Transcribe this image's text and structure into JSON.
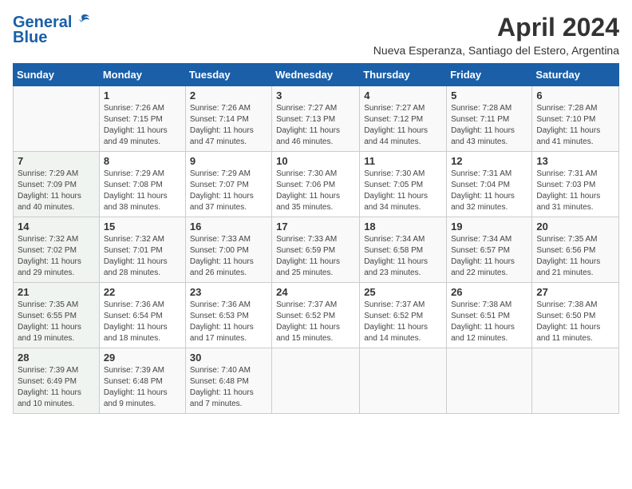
{
  "logo": {
    "line1": "General",
    "line2": "Blue"
  },
  "title": "April 2024",
  "subtitle": "Nueva Esperanza, Santiago del Estero, Argentina",
  "header_days": [
    "Sunday",
    "Monday",
    "Tuesday",
    "Wednesday",
    "Thursday",
    "Friday",
    "Saturday"
  ],
  "weeks": [
    [
      {
        "day": "",
        "info": ""
      },
      {
        "day": "1",
        "info": "Sunrise: 7:26 AM\nSunset: 7:15 PM\nDaylight: 11 hours\nand 49 minutes."
      },
      {
        "day": "2",
        "info": "Sunrise: 7:26 AM\nSunset: 7:14 PM\nDaylight: 11 hours\nand 47 minutes."
      },
      {
        "day": "3",
        "info": "Sunrise: 7:27 AM\nSunset: 7:13 PM\nDaylight: 11 hours\nand 46 minutes."
      },
      {
        "day": "4",
        "info": "Sunrise: 7:27 AM\nSunset: 7:12 PM\nDaylight: 11 hours\nand 44 minutes."
      },
      {
        "day": "5",
        "info": "Sunrise: 7:28 AM\nSunset: 7:11 PM\nDaylight: 11 hours\nand 43 minutes."
      },
      {
        "day": "6",
        "info": "Sunrise: 7:28 AM\nSunset: 7:10 PM\nDaylight: 11 hours\nand 41 minutes."
      }
    ],
    [
      {
        "day": "7",
        "info": "Sunrise: 7:29 AM\nSunset: 7:09 PM\nDaylight: 11 hours\nand 40 minutes."
      },
      {
        "day": "8",
        "info": "Sunrise: 7:29 AM\nSunset: 7:08 PM\nDaylight: 11 hours\nand 38 minutes."
      },
      {
        "day": "9",
        "info": "Sunrise: 7:29 AM\nSunset: 7:07 PM\nDaylight: 11 hours\nand 37 minutes."
      },
      {
        "day": "10",
        "info": "Sunrise: 7:30 AM\nSunset: 7:06 PM\nDaylight: 11 hours\nand 35 minutes."
      },
      {
        "day": "11",
        "info": "Sunrise: 7:30 AM\nSunset: 7:05 PM\nDaylight: 11 hours\nand 34 minutes."
      },
      {
        "day": "12",
        "info": "Sunrise: 7:31 AM\nSunset: 7:04 PM\nDaylight: 11 hours\nand 32 minutes."
      },
      {
        "day": "13",
        "info": "Sunrise: 7:31 AM\nSunset: 7:03 PM\nDaylight: 11 hours\nand 31 minutes."
      }
    ],
    [
      {
        "day": "14",
        "info": "Sunrise: 7:32 AM\nSunset: 7:02 PM\nDaylight: 11 hours\nand 29 minutes."
      },
      {
        "day": "15",
        "info": "Sunrise: 7:32 AM\nSunset: 7:01 PM\nDaylight: 11 hours\nand 28 minutes."
      },
      {
        "day": "16",
        "info": "Sunrise: 7:33 AM\nSunset: 7:00 PM\nDaylight: 11 hours\nand 26 minutes."
      },
      {
        "day": "17",
        "info": "Sunrise: 7:33 AM\nSunset: 6:59 PM\nDaylight: 11 hours\nand 25 minutes."
      },
      {
        "day": "18",
        "info": "Sunrise: 7:34 AM\nSunset: 6:58 PM\nDaylight: 11 hours\nand 23 minutes."
      },
      {
        "day": "19",
        "info": "Sunrise: 7:34 AM\nSunset: 6:57 PM\nDaylight: 11 hours\nand 22 minutes."
      },
      {
        "day": "20",
        "info": "Sunrise: 7:35 AM\nSunset: 6:56 PM\nDaylight: 11 hours\nand 21 minutes."
      }
    ],
    [
      {
        "day": "21",
        "info": "Sunrise: 7:35 AM\nSunset: 6:55 PM\nDaylight: 11 hours\nand 19 minutes."
      },
      {
        "day": "22",
        "info": "Sunrise: 7:36 AM\nSunset: 6:54 PM\nDaylight: 11 hours\nand 18 minutes."
      },
      {
        "day": "23",
        "info": "Sunrise: 7:36 AM\nSunset: 6:53 PM\nDaylight: 11 hours\nand 17 minutes."
      },
      {
        "day": "24",
        "info": "Sunrise: 7:37 AM\nSunset: 6:52 PM\nDaylight: 11 hours\nand 15 minutes."
      },
      {
        "day": "25",
        "info": "Sunrise: 7:37 AM\nSunset: 6:52 PM\nDaylight: 11 hours\nand 14 minutes."
      },
      {
        "day": "26",
        "info": "Sunrise: 7:38 AM\nSunset: 6:51 PM\nDaylight: 11 hours\nand 12 minutes."
      },
      {
        "day": "27",
        "info": "Sunrise: 7:38 AM\nSunset: 6:50 PM\nDaylight: 11 hours\nand 11 minutes."
      }
    ],
    [
      {
        "day": "28",
        "info": "Sunrise: 7:39 AM\nSunset: 6:49 PM\nDaylight: 11 hours\nand 10 minutes."
      },
      {
        "day": "29",
        "info": "Sunrise: 7:39 AM\nSunset: 6:48 PM\nDaylight: 11 hours\nand 9 minutes."
      },
      {
        "day": "30",
        "info": "Sunrise: 7:40 AM\nSunset: 6:48 PM\nDaylight: 11 hours\nand 7 minutes."
      },
      {
        "day": "",
        "info": ""
      },
      {
        "day": "",
        "info": ""
      },
      {
        "day": "",
        "info": ""
      },
      {
        "day": "",
        "info": ""
      }
    ]
  ]
}
